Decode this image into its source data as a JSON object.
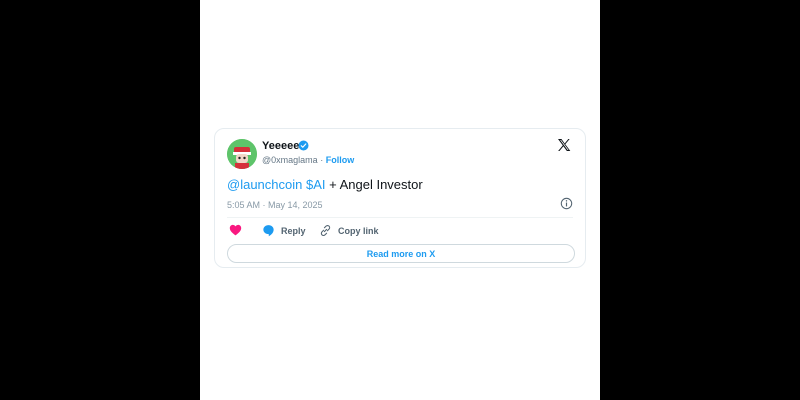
{
  "tweet": {
    "display_name": "Yeeeee",
    "handle": "@0xmaglama",
    "separator": "·",
    "follow_label": "Follow",
    "text_mention": "@launchcoin",
    "text_cashtag": "$AI",
    "text_rest": " + Angel Investor",
    "timestamp": "5:05 AM · May 14, 2025",
    "reply_label": "Reply",
    "copy_link_label": "Copy link",
    "read_more_label": "Read more on X"
  },
  "icons": {
    "verified": "verified-badge-icon",
    "x_logo": "x-logo-icon",
    "info": "info-icon",
    "like": "heart-icon",
    "reply": "reply-bubble-icon",
    "copy_link": "link-icon"
  },
  "colors": {
    "accent": "#1d9bf0",
    "like": "#f91880",
    "page_bg": "#000000",
    "viewport_bg": "#ffffff"
  }
}
